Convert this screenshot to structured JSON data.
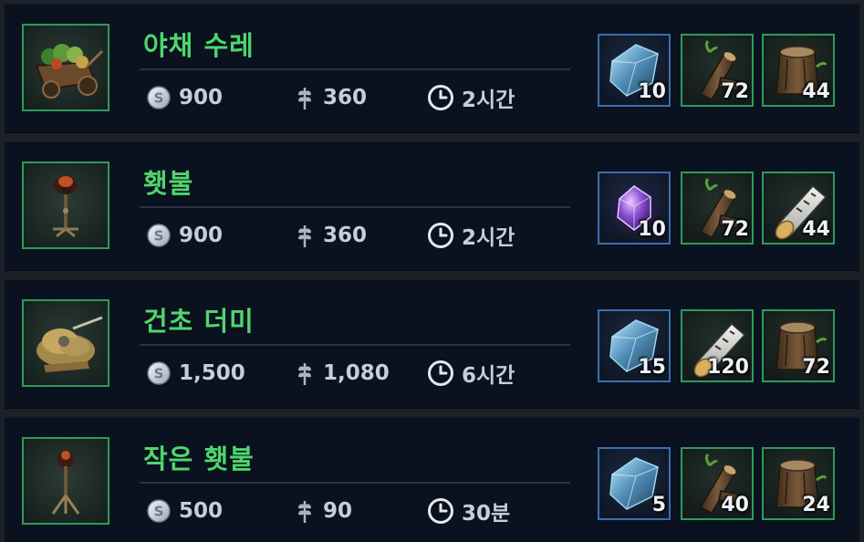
{
  "recipes": [
    {
      "title": "야채 수레",
      "cost_silver": "900",
      "cost_grain": "360",
      "time": "2시간",
      "thumb_icon": "vegetable-cart-icon",
      "materials": [
        {
          "icon": "blue-crystal-icon",
          "qty": "10",
          "frame": "blue"
        },
        {
          "icon": "log-branch-icon",
          "qty": "72",
          "frame": "green"
        },
        {
          "icon": "tree-stump-icon",
          "qty": "44",
          "frame": "green"
        }
      ]
    },
    {
      "title": "횃불",
      "cost_silver": "900",
      "cost_grain": "360",
      "time": "2시간",
      "thumb_icon": "torch-icon",
      "materials": [
        {
          "icon": "purple-gem-icon",
          "qty": "10",
          "frame": "blue"
        },
        {
          "icon": "log-branch-icon",
          "qty": "72",
          "frame": "green"
        },
        {
          "icon": "birch-log-icon",
          "qty": "44",
          "frame": "green"
        }
      ]
    },
    {
      "title": "건초 더미",
      "cost_silver": "1,500",
      "cost_grain": "1,080",
      "time": "6시간",
      "thumb_icon": "hay-pile-icon",
      "materials": [
        {
          "icon": "blue-crystal-icon",
          "qty": "15",
          "frame": "blue"
        },
        {
          "icon": "birch-log-icon",
          "qty": "120",
          "frame": "green"
        },
        {
          "icon": "tree-stump-icon",
          "qty": "72",
          "frame": "green"
        }
      ]
    },
    {
      "title": "작은 횃불",
      "cost_silver": "500",
      "cost_grain": "90",
      "time": "30분",
      "thumb_icon": "small-torch-icon",
      "materials": [
        {
          "icon": "blue-crystal-icon",
          "qty": "5",
          "frame": "blue"
        },
        {
          "icon": "log-branch-icon",
          "qty": "40",
          "frame": "green"
        },
        {
          "icon": "tree-stump-icon",
          "qty": "24",
          "frame": "green"
        }
      ]
    }
  ],
  "colors": {
    "title_green": "#4fd66c",
    "frame_green": "#2f9a5a",
    "frame_blue": "#3a6fb0",
    "row_bg": "#0a111f",
    "stat_text": "#c9ced6"
  }
}
